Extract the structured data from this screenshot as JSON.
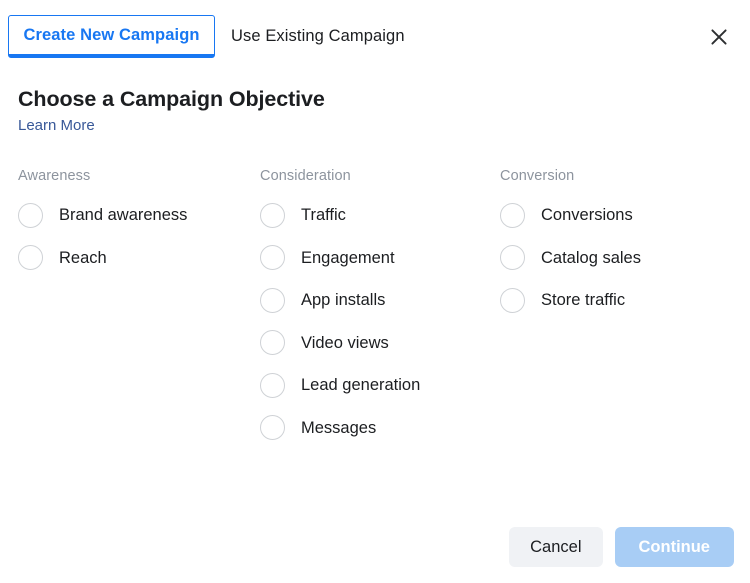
{
  "tabs": [
    {
      "label": "Create New Campaign",
      "active": true
    },
    {
      "label": "Use Existing Campaign",
      "active": false
    }
  ],
  "close": {
    "icon": "close-icon",
    "label": "Close"
  },
  "heading": {
    "title": "Choose a Campaign Objective",
    "learn_more": "Learn More"
  },
  "columns": [
    {
      "title": "Awareness",
      "options": [
        {
          "label": "Brand awareness",
          "selected": false
        },
        {
          "label": "Reach",
          "selected": false
        }
      ]
    },
    {
      "title": "Consideration",
      "options": [
        {
          "label": "Traffic",
          "selected": false
        },
        {
          "label": "Engagement",
          "selected": false
        },
        {
          "label": "App installs",
          "selected": false
        },
        {
          "label": "Video views",
          "selected": false
        },
        {
          "label": "Lead generation",
          "selected": false
        },
        {
          "label": "Messages",
          "selected": false
        }
      ]
    },
    {
      "title": "Conversion",
      "options": [
        {
          "label": "Conversions",
          "selected": false
        },
        {
          "label": "Catalog sales",
          "selected": false
        },
        {
          "label": "Store traffic",
          "selected": false
        }
      ]
    }
  ],
  "footer": {
    "cancel_label": "Cancel",
    "continue_label": "Continue",
    "continue_disabled": true
  },
  "colors": {
    "accent": "#1877f2",
    "link": "#385898",
    "text": "#1c1e21",
    "muted": "#8d949e",
    "radio_border": "#cfd2d6",
    "cancel_bg": "#f0f2f5",
    "continue_disabled_bg": "#a8cdf5"
  }
}
